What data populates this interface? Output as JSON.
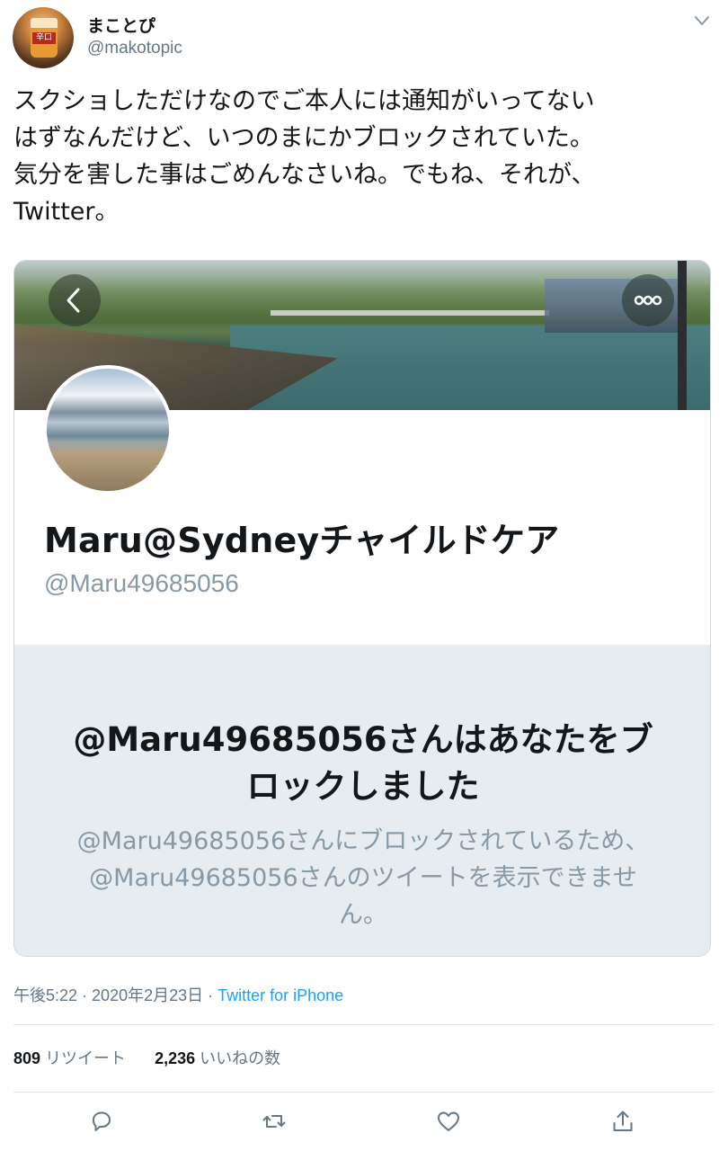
{
  "tweet": {
    "author_name": "まことぴ",
    "author_handle": "@makotopic",
    "avatar_label": "辛口",
    "text": "スクショしただけなのでご本人には通知がいってない\nはずなんだけど、いつのまにかブロックされていた。\n気分を害した事はごめんなさいね。でもね、それが、\nTwitter。",
    "time": "午後5:22",
    "date": "2020年2月23日",
    "separator": " · ",
    "source": "Twitter for iPhone",
    "retweets": "809",
    "retweets_label": "リツイート",
    "likes": "2,236",
    "likes_label": "いいねの数"
  },
  "card": {
    "profile_name": "Maru@Sydneyチャイルドケア",
    "profile_handle": "@Maru49685056",
    "blocked_title": "@Maru49685056さんはあなたをブロックしました",
    "blocked_desc": "@Maru49685056さんにブロックされているため、@Maru49685056さんのツイートを表示できません。"
  },
  "colors": {
    "accent": "#1da1f2",
    "secondary_text": "#657786",
    "muted_text": "#8899a6",
    "blocked_bg": "#e6ecf0"
  },
  "icons": {
    "menu": "chevron-down-icon",
    "back": "chevron-left-icon",
    "more": "more-icon",
    "reply": "reply-icon",
    "retweet": "retweet-icon",
    "like": "heart-icon",
    "share": "share-icon"
  }
}
